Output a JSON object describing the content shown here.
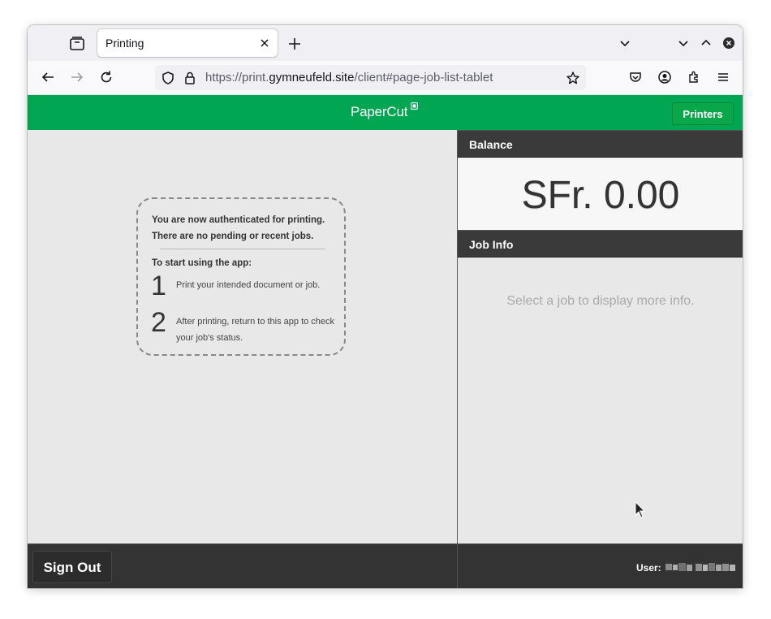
{
  "browser": {
    "tab_title": "Printing",
    "url_prefix": "https://print.",
    "url_host": "gymneufeld.site",
    "url_path": "/client#page-job-list-tablet"
  },
  "header": {
    "logo_text": "PaperCut",
    "printers_label": "Printers",
    "accent_color": "#00a651"
  },
  "info_box": {
    "authenticated": "You are now authenticated for printing.",
    "no_jobs": "There are no pending or recent jobs.",
    "start_heading": "To start using the app:",
    "steps": [
      {
        "num": "1",
        "text": "Print your intended document or job."
      },
      {
        "num": "2",
        "text": "After printing, return to this app to check your job's status."
      }
    ]
  },
  "balance": {
    "heading": "Balance",
    "value": "SFr. 0.00"
  },
  "job_info": {
    "heading": "Job Info",
    "empty_message": "Select a job to display more info."
  },
  "footer": {
    "signout_label": "Sign Out",
    "user_label": "User:"
  }
}
